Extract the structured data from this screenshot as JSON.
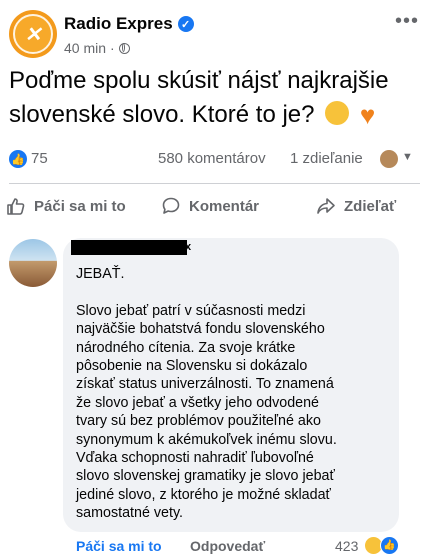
{
  "colors": {
    "accent": "#1877f2",
    "brand": "#f39a1c",
    "secondary_text": "#65676b"
  },
  "post": {
    "page_name": "Radio Expres",
    "time": "40 min",
    "separator": "·",
    "text": "Poďme spolu skúsiť nájsť najkrajšie slovenské slovo. Ktoré to je?",
    "emojis": [
      "thinking-face",
      "orange-heart"
    ]
  },
  "stats": {
    "likes": "75",
    "comments": "580 komentárov",
    "shares": "1 zdieľanie"
  },
  "actions": {
    "like": "Páči sa mi to",
    "comment": "Komentár",
    "share": "Zdieľať"
  },
  "comment": {
    "name_tail": "x",
    "lines": [
      "JEBAŤ.",
      "",
      "Slovo jebať patrí v súčasnosti medzi",
      "najväčšie bohatstvá fondu slovenského",
      "národného cítenia. Za svoje krátke",
      "pôsobenie na Slovensku si dokázalo",
      "získať status univerzálnosti. To znamená",
      "že slovo jebať a všetky jeho odvodené",
      "tvary sú bez problémov použiteľné ako",
      "synonymum k akémukoľvek inému slovu.",
      "Vďaka schopnosti nahradiť ľubovoľné",
      "slovo slovenskej gramatiky je slovo jebať",
      "jediné slovo, z ktorého je možné skladať",
      "samostatné vety."
    ],
    "like_label": "Páči sa mi to",
    "reply_label": "Odpovedať",
    "reactions_count": "423"
  }
}
